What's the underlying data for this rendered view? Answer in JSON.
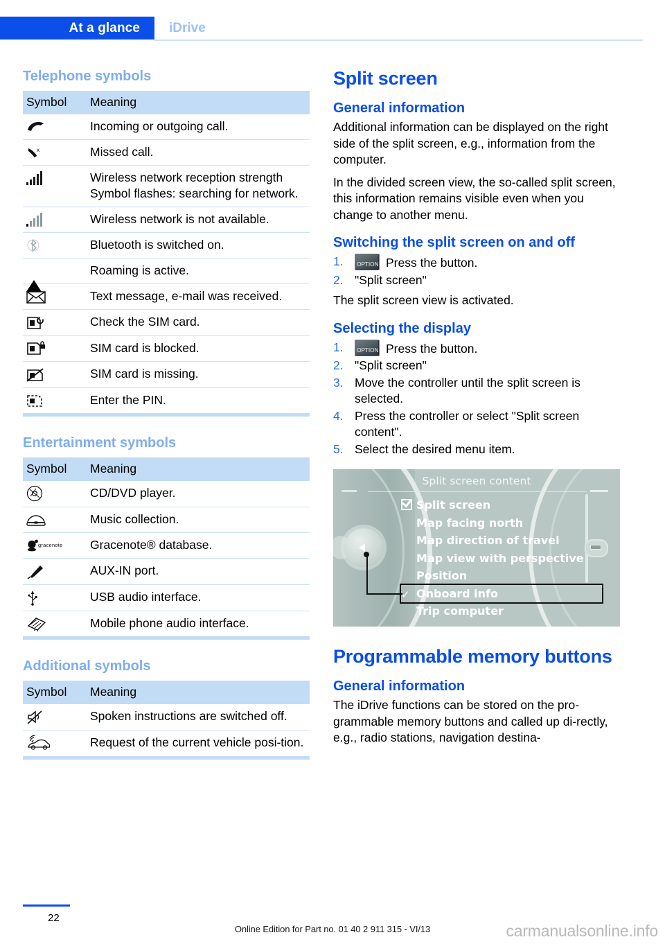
{
  "header": {
    "tab_active": "At a glance",
    "tab_inactive": "iDrive"
  },
  "left_column": {
    "telephone": {
      "heading": "Telephone symbols",
      "columns": [
        "Symbol",
        "Meaning"
      ],
      "rows": [
        {
          "icon": "phone-handset-icon",
          "meaning": "Incoming or outgoing call."
        },
        {
          "icon": "missed-call-icon",
          "meaning": "Missed call."
        },
        {
          "icon": "signal-bars-icon",
          "meaning": "Wireless network reception strength Symbol flashes: searching for network."
        },
        {
          "icon": "signal-bars-grey-icon",
          "meaning": "Wireless network is not available."
        },
        {
          "icon": "bluetooth-icon",
          "meaning": "Bluetooth is switched on."
        },
        {
          "icon": "roaming-triangle-icon",
          "meaning": "Roaming is active."
        },
        {
          "icon": "envelope-icon",
          "meaning": "Text message, e-mail was received."
        },
        {
          "icon": "sim-check-icon",
          "meaning": "Check the SIM card."
        },
        {
          "icon": "sim-locked-icon",
          "meaning": "SIM card is blocked."
        },
        {
          "icon": "sim-missing-icon",
          "meaning": "SIM card is missing."
        },
        {
          "icon": "sim-pin-icon",
          "meaning": "Enter the PIN."
        }
      ]
    },
    "entertainment": {
      "heading": "Entertainment symbols",
      "columns": [
        "Symbol",
        "Meaning"
      ],
      "rows": [
        {
          "icon": "cd-dvd-icon",
          "meaning": "CD/DVD player."
        },
        {
          "icon": "music-collection-icon",
          "meaning": "Music collection."
        },
        {
          "icon": "gracenote-logo-icon",
          "meaning": "Gracenote® database."
        },
        {
          "icon": "aux-in-plug-icon",
          "meaning": "AUX-IN port."
        },
        {
          "icon": "usb-icon",
          "meaning": "USB audio interface."
        },
        {
          "icon": "mobile-phone-audio-icon",
          "meaning": "Mobile phone audio interface."
        }
      ]
    },
    "additional": {
      "heading": "Additional symbols",
      "columns": [
        "Symbol",
        "Meaning"
      ],
      "rows": [
        {
          "icon": "muted-speaker-icon",
          "meaning": "Spoken instructions are switched off."
        },
        {
          "icon": "vehicle-position-icon",
          "meaning": "Request of the current vehicle posi-tion."
        }
      ]
    }
  },
  "right_column": {
    "split_screen": {
      "title": "Split screen",
      "general_information": {
        "heading": "General information",
        "paragraphs": [
          "Additional information can be displayed on the right side of the split screen, e.g., information from the computer.",
          "In the divided screen view, the so-called split screen, this information remains visible even when you change to another menu."
        ]
      },
      "switching": {
        "heading": "Switching the split screen on and off",
        "steps": [
          {
            "num": "1.",
            "icon": "option-button-icon",
            "text": "Press the button."
          },
          {
            "num": "2.",
            "icon": "",
            "text": "\"Split screen\""
          }
        ],
        "result": "The split screen view is activated."
      },
      "selecting": {
        "heading": "Selecting the display",
        "steps": [
          {
            "num": "1.",
            "icon": "option-button-icon",
            "text": "Press the button."
          },
          {
            "num": "2.",
            "icon": "",
            "text": "\"Split screen\""
          },
          {
            "num": "3.",
            "icon": "",
            "text": "Move the controller until the split screen is selected."
          },
          {
            "num": "4.",
            "icon": "",
            "text": "Press the controller or select \"Split screen content\"."
          },
          {
            "num": "5.",
            "icon": "",
            "text": "Select the desired menu item."
          }
        ]
      }
    },
    "idrive_screenshot": {
      "title": "Split screen content",
      "menu_items": [
        {
          "label": "Split screen",
          "marker": "checkbox",
          "highlighted": false
        },
        {
          "label": "Map facing north",
          "marker": "none",
          "highlighted": false
        },
        {
          "label": "Map direction of travel",
          "marker": "none",
          "highlighted": false
        },
        {
          "label": "Map view with perspective",
          "marker": "none",
          "highlighted": false
        },
        {
          "label": "Position",
          "marker": "none",
          "highlighted": false
        },
        {
          "label": "Onboard info",
          "marker": "check",
          "highlighted": true
        },
        {
          "label": "Trip computer",
          "marker": "none",
          "highlighted": false
        }
      ]
    },
    "memory_buttons": {
      "title": "Programmable memory buttons",
      "general_information": {
        "heading": "General information",
        "paragraphs": [
          "The iDrive functions can be stored on the pro-grammable memory buttons and called up di-rectly, e.g., radio stations, navigation destina-"
        ]
      }
    }
  },
  "footer": {
    "page_number": "22",
    "note": "Online Edition for Part no. 01 40 2 911 315 - VI/13",
    "watermark": "carmanualsonline.info"
  },
  "colors": {
    "brand_blue": "#0b4ee8",
    "light_blue": "#7fadf0",
    "table_header_bg": "#c3dcf5",
    "row_divider": "#cfe0fb"
  }
}
